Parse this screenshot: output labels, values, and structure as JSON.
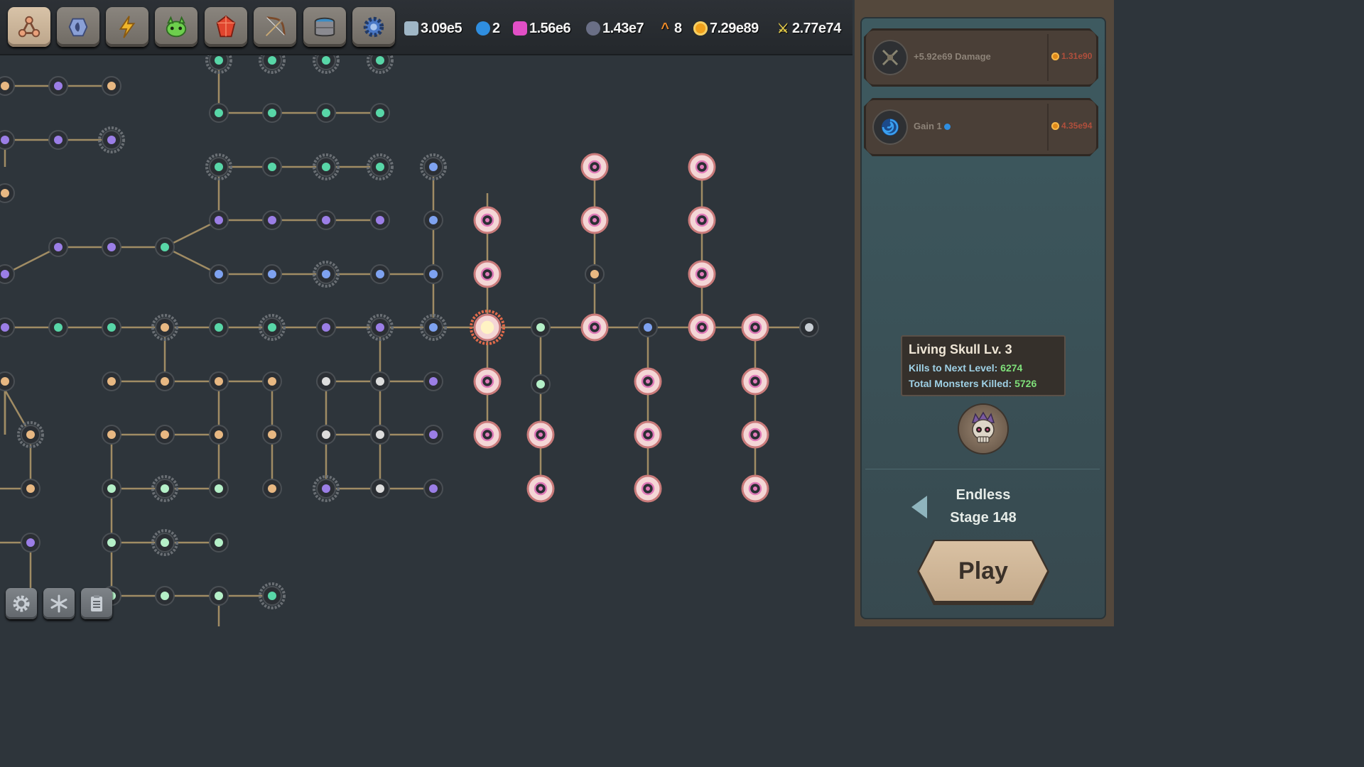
{
  "toolbar": {
    "tabs": [
      {
        "name": "skill-tree-tab",
        "icon": "skill-tree-icon",
        "active": true
      },
      {
        "name": "rune-tab",
        "icon": "rune-stone-icon",
        "active": false
      },
      {
        "name": "lightning-tab",
        "icon": "lightning-icon",
        "active": false
      },
      {
        "name": "monster-tab",
        "icon": "green-monster-icon",
        "active": false
      },
      {
        "name": "gem-tab",
        "icon": "red-gem-icon",
        "active": false
      },
      {
        "name": "bow-tab",
        "icon": "bow-icon",
        "active": false
      },
      {
        "name": "well-tab",
        "icon": "well-icon",
        "active": false
      },
      {
        "name": "gear-tab",
        "icon": "blue-gear-icon",
        "active": false
      }
    ]
  },
  "resources": [
    {
      "name": "gear-resource",
      "icon": "gear-resource-icon",
      "value": "3.09e5",
      "color": "#9fb6c6"
    },
    {
      "name": "vortex-resource",
      "icon": "blue-swirl-icon",
      "value": "2",
      "color": "#2f8ee0"
    },
    {
      "name": "pink-gem-resource",
      "icon": "pink-gem-icon",
      "value": "1.56e6",
      "color": "#e24fc6"
    },
    {
      "name": "dark-orb-resource",
      "icon": "dark-orb-icon",
      "value": "1.43e7",
      "color": "#6a6f86"
    },
    {
      "name": "rank-resource",
      "icon": "chevron-up-icon",
      "value": "8",
      "color": "#e9892a"
    },
    {
      "name": "gold-resource",
      "icon": "gold-coin-icon",
      "value": "7.29e89",
      "color": "#f0a11c"
    },
    {
      "name": "damage-resource",
      "icon": "crossed-swords-icon",
      "value": "2.77e74",
      "color": "#e0c84a"
    }
  ],
  "upgrades": [
    {
      "name": "damage-upgrade",
      "icon": "crossed-swords-icon",
      "label": "+5.92e69 Damage",
      "cost": "1.31e90"
    },
    {
      "name": "gain-upgrade",
      "icon": "blue-swirl-icon",
      "label": "Gain 1",
      "cost": "4.35e94"
    }
  ],
  "monster": {
    "title": "Living Skull Lv. 3",
    "kills_label": "Kills to Next Level:",
    "kills_value": "6274",
    "total_label": "Total Monsters Killed:",
    "total_value": "5726",
    "icon": "skull-icon"
  },
  "stage": {
    "mode": "Endless",
    "label": "Stage 148"
  },
  "play_label": "Play",
  "bottom_buttons": [
    {
      "name": "settings-button",
      "icon": "gear-icon"
    },
    {
      "name": "effects-button",
      "icon": "snowflake-icon"
    },
    {
      "name": "notes-button",
      "icon": "clipboard-icon"
    }
  ],
  "colors": {
    "edge": "#a08c64",
    "green": "#58d6a7",
    "purple": "#9b7ee6",
    "blue": "#7ea2f0",
    "pink": "#e07ab8",
    "cream": "#e8b882",
    "mint": "#b5f0c8",
    "node_fill": "#2b2f34",
    "pink_fill": "#f4d6d6"
  }
}
